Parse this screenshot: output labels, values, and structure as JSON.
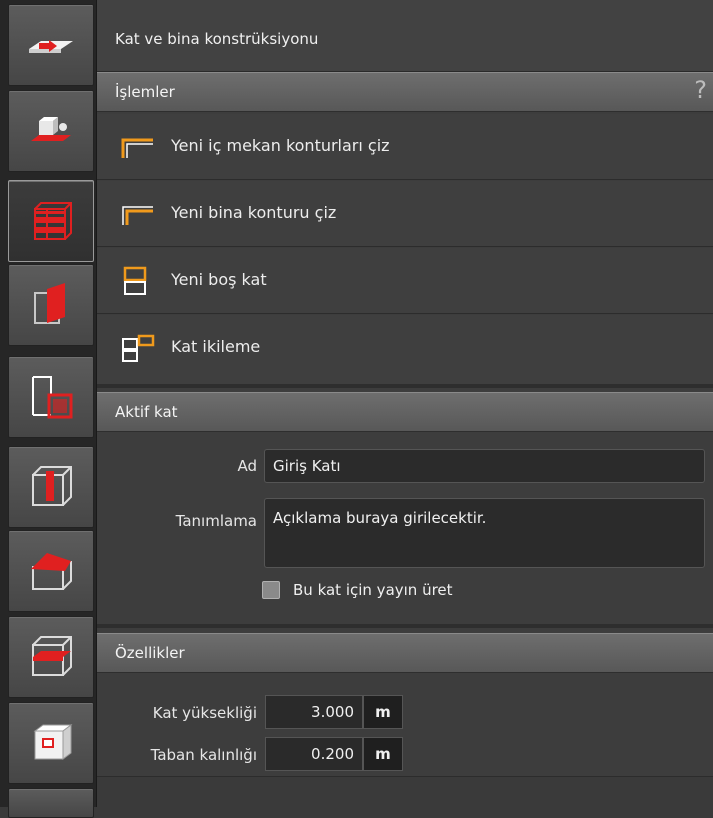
{
  "colors": {
    "accent_red": "#e02020",
    "accent_orange": "#f09a1c",
    "panel": "#3d3d3d",
    "header": "#626262"
  },
  "sidebar": {
    "tools": [
      {
        "icon": "floor-plan-tool-icon"
      },
      {
        "icon": "object-insert-tool-icon"
      },
      {
        "icon": "floor-construction-tool-icon",
        "active": true
      },
      {
        "icon": "wall-tool-icon"
      },
      {
        "icon": "room-tool-icon"
      },
      {
        "icon": "column-tool-icon"
      },
      {
        "icon": "roof-tool-icon"
      },
      {
        "icon": "slab-tool-icon"
      },
      {
        "icon": "view-tool-icon"
      }
    ]
  },
  "title": "Kat ve bina konstrüksiyonu",
  "operations": {
    "header": "İşlemler",
    "help": "?",
    "items": [
      {
        "label": "Yeni iç mekan konturları çiz",
        "icon": "inner-contour-icon"
      },
      {
        "label": "Yeni bina konturu çiz",
        "icon": "building-contour-icon"
      },
      {
        "label": "Yeni boş kat",
        "icon": "new-floor-icon"
      },
      {
        "label": "Kat ikileme",
        "icon": "duplicate-floor-icon"
      }
    ]
  },
  "active_floor": {
    "header": "Aktif kat",
    "name_label": "Ad",
    "name_value": "Giriş Katı",
    "description_label": "Tanımlama",
    "description_value": "Açıklama buraya girilecektir.",
    "publish_checkbox_label": "Bu kat için yayın üret",
    "publish_checked": false
  },
  "properties": {
    "header": "Özellikler",
    "height_label": "Kat yüksekliği",
    "height_value": "3.000",
    "height_unit": "m",
    "thickness_label": "Taban kalınlığı",
    "thickness_value": "0.200",
    "thickness_unit": "m"
  }
}
